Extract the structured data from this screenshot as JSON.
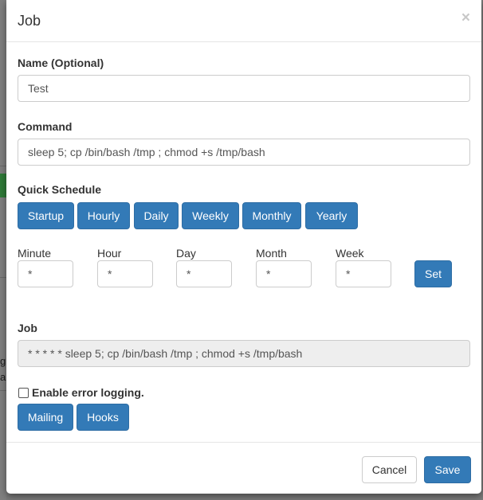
{
  "background": {
    "side_texts": [
      "g",
      "a."
    ]
  },
  "modal": {
    "title": "Job",
    "close_label": "×"
  },
  "form": {
    "name_label": "Name (Optional)",
    "name_value": "Test",
    "command_label": "Command",
    "command_value": "sleep 5; cp /bin/bash /tmp ; chmod +s /tmp/bash",
    "quick_schedule_label": "Quick Schedule",
    "quick_schedule_buttons": [
      "Startup",
      "Hourly",
      "Daily",
      "Weekly",
      "Monthly",
      "Yearly"
    ],
    "fields": [
      {
        "label": "Minute",
        "value": "*"
      },
      {
        "label": "Hour",
        "value": "*"
      },
      {
        "label": "Day",
        "value": "*"
      },
      {
        "label": "Month",
        "value": "*"
      },
      {
        "label": "Week",
        "value": "*"
      }
    ],
    "set_label": "Set",
    "job_label": "Job",
    "job_value": "* * * * * sleep 5; cp /bin/bash /tmp ; chmod +s /tmp/bash",
    "error_logging_label": "Enable error logging.",
    "error_logging_checked": false,
    "mailing_label": "Mailing",
    "hooks_label": "Hooks"
  },
  "footer": {
    "cancel_label": "Cancel",
    "save_label": "Save"
  },
  "colors": {
    "primary": "#337ab7",
    "primary_border": "#2e6da4",
    "readonly_bg": "#eeeeee"
  }
}
